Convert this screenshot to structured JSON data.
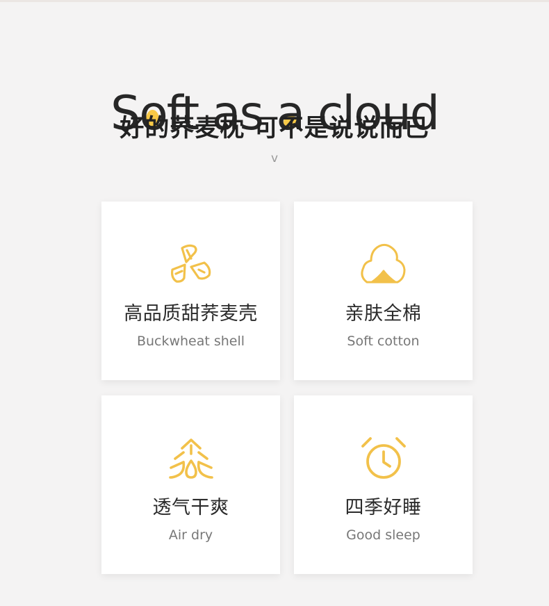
{
  "headline": {
    "part1": "S",
    "o_letter": "o",
    "part2": "ft as ",
    "a_letter": "a",
    "part3": " cloud"
  },
  "subheadline": "好的荞麦枕 可不是说说而已",
  "scroll_hint": "v",
  "accent_color": "#f8c947",
  "background_color": "#f4f3f3",
  "features": [
    {
      "title": "高品质甜荞麦壳",
      "subtitle": "Buckwheat shell",
      "icon": "buckwheat-shell-icon"
    },
    {
      "title": "亲肤全棉",
      "subtitle": "Soft cotton",
      "icon": "cotton-boll-icon"
    },
    {
      "title": "透气干爽",
      "subtitle": "Air dry",
      "icon": "air-flow-icon"
    },
    {
      "title": "四季好睡",
      "subtitle": "Good sleep",
      "icon": "alarm-clock-icon"
    }
  ]
}
